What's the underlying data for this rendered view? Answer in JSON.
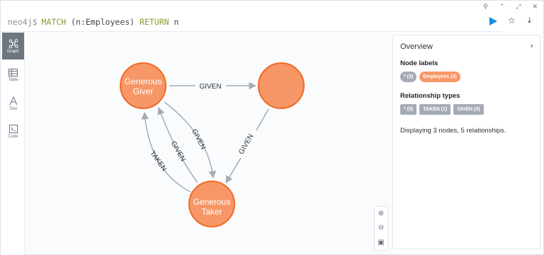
{
  "window": {
    "controls": [
      "pin-icon",
      "chevron-up-icon",
      "expand-icon",
      "close-icon"
    ]
  },
  "editor": {
    "prompt": "neo4j$",
    "query_kw1": "MATCH",
    "query_mid": " (n:Employees) ",
    "query_kw2": "RETURN",
    "query_end": " n"
  },
  "rail": {
    "items": [
      {
        "label": "Graph",
        "icon": "graph-icon",
        "active": true
      },
      {
        "label": "Table",
        "icon": "table-icon",
        "active": false
      },
      {
        "label": "Text",
        "icon": "text-icon",
        "active": false
      },
      {
        "label": "Code",
        "icon": "code-icon",
        "active": false
      }
    ]
  },
  "graph": {
    "nodes": [
      {
        "id": "giver",
        "line1": "Generous",
        "line2": "Giver"
      },
      {
        "id": "unnamed",
        "line1": "",
        "line2": ""
      },
      {
        "id": "taker",
        "line1": "Generous",
        "line2": "Taker"
      }
    ],
    "relationships": [
      {
        "from": "giver",
        "to": "unnamed",
        "type": "GIVEN"
      },
      {
        "from": "giver",
        "to": "taker",
        "type": "GIVEN"
      },
      {
        "from": "taker",
        "to": "giver",
        "type": "GIVEN"
      },
      {
        "from": "taker",
        "to": "giver",
        "type": "TAKEN"
      },
      {
        "from": "unnamed",
        "to": "taker",
        "type": "GIVEN"
      }
    ],
    "colors": {
      "node_fill": "#f79767",
      "node_stroke": "#f36924",
      "edge": "#a5abb6"
    }
  },
  "zoom": {
    "buttons": [
      "zoom-in-icon",
      "zoom-out-icon",
      "fit-icon"
    ]
  },
  "overview": {
    "title": "Overview",
    "node_labels_heading": "Node labels",
    "node_chip_all": "* (3)",
    "node_chip_employees": "Employees (3)",
    "rel_types_heading": "Relationship types",
    "rel_chip_all": "* (5)",
    "rel_chip_taken": "TAKEN (1)",
    "rel_chip_given": "GIVEN (4)",
    "summary": "Displaying 3 nodes, 5 relationships.",
    "colors": {
      "chip_gray": "#a5abb6",
      "chip_orange": "#f79767"
    }
  }
}
